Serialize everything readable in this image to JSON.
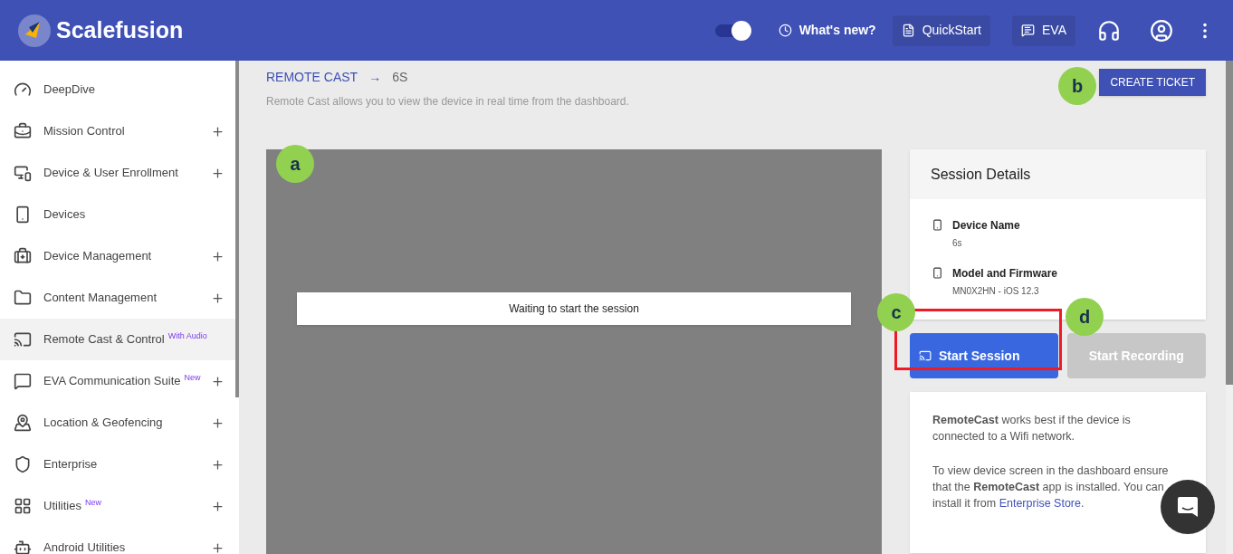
{
  "header": {
    "brand": "Scalefusion",
    "toggle": {
      "on": true
    },
    "whats_new": "What's new?",
    "quickstart": "QuickStart",
    "eva": "EVA"
  },
  "sidebar": {
    "items": [
      {
        "label": "DeepDive",
        "expandable": false,
        "selected": false
      },
      {
        "label": "Mission Control",
        "expandable": true,
        "selected": false
      },
      {
        "label": "Device & User Enrollment",
        "expandable": true,
        "selected": false
      },
      {
        "label": "Devices",
        "expandable": false,
        "selected": false
      },
      {
        "label": "Device Management",
        "expandable": true,
        "selected": false
      },
      {
        "label": "Content Management",
        "expandable": true,
        "selected": false
      },
      {
        "label": "Remote Cast & Control",
        "badge": "With Audio",
        "expandable": false,
        "selected": true
      },
      {
        "label": "EVA Communication Suite",
        "badge": "New",
        "expandable": true,
        "selected": false
      },
      {
        "label": "Location & Geofencing",
        "expandable": true,
        "selected": false
      },
      {
        "label": "Enterprise",
        "expandable": true,
        "selected": false
      },
      {
        "label": "Utilities",
        "badge": "New",
        "expandable": true,
        "selected": false
      },
      {
        "label": "Android Utilities",
        "expandable": true,
        "selected": false
      }
    ]
  },
  "breadcrumb": {
    "parent": "REMOTE CAST",
    "arrow": "→",
    "current": "6S"
  },
  "description": "Remote Cast allows you to view the device in real time from the dashboard.",
  "create_ticket": "CREATE TICKET",
  "viewer": {
    "status": "Waiting to start the session"
  },
  "session_details": {
    "title": "Session Details",
    "fields": [
      {
        "label": "Device Name",
        "value": "6s"
      },
      {
        "label": "Model and Firmware",
        "value": "MN0X2HN - iOS 12.3"
      }
    ]
  },
  "start_session": {
    "label": "Start Session",
    "highlighted": true
  },
  "start_recording": {
    "label": "Start Recording",
    "disabled": true
  },
  "info": {
    "paragraph_1": "**RemoteCast** works best if the device is connected to a Wifi network.",
    "paragraph_2": "To view device screen in the dashboard ensure that the **RemoteCast** app is installed. You can install it from",
    "link": "Enterprise Store",
    "paragraph_2_end": "."
  },
  "callouts": [
    {
      "label": "a"
    },
    {
      "label": "b"
    },
    {
      "label": "c"
    },
    {
      "label": "d"
    }
  ]
}
